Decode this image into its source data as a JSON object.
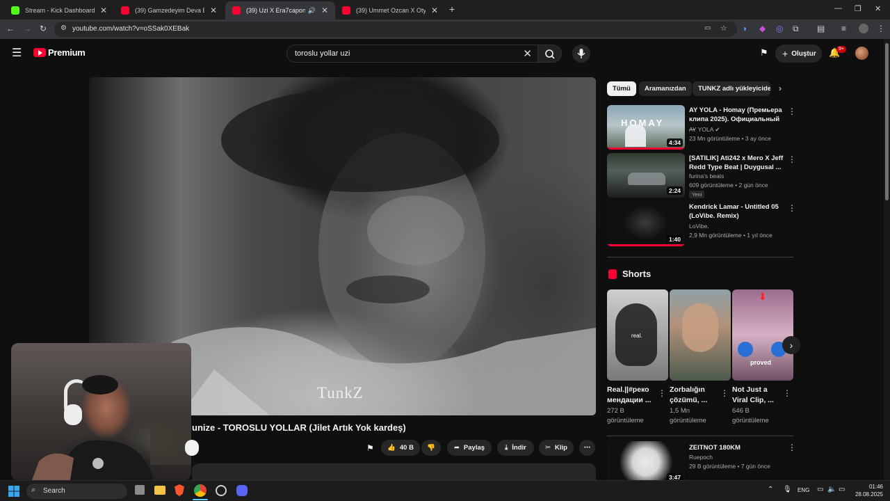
{
  "browser": {
    "tabs": [
      {
        "title": "Stream - Kick Dashboard",
        "favicon": "kick-icon",
        "color": "#53fc18",
        "active": false
      },
      {
        "title": "(39) Gamzedeyim Deva Bulmam",
        "favicon": "youtube-icon",
        "color": "#ff0033",
        "active": false
      },
      {
        "title": "(39) Uzi X Era7capone X Ov",
        "favicon": "youtube-icon",
        "color": "#ff0033",
        "active": true
      },
      {
        "title": "(39) Ummet Ozcan X Otyken Al",
        "favicon": "youtube-icon",
        "color": "#ff0033",
        "active": false
      }
    ],
    "url": "youtube.com/watch?v=oSSak0XEBak"
  },
  "youtube": {
    "logo_label": "Premium",
    "search": {
      "value": "toroslu yollar uzi"
    },
    "create_label": "Oluştur",
    "notif_count": "9+",
    "player": {
      "watermark": "TunkZ"
    },
    "video": {
      "title": "unize - TOROSLU YOLLAR (Jilet Artık Yok kardeş)",
      "likes": "40 B",
      "share_label": "Paylaş",
      "download_label": "İndir",
      "clip_label": "Klip"
    },
    "chips": [
      "Tümü",
      "Aramanızdan",
      "TUNKZ adlı yükleyiciden"
    ],
    "recommendations": [
      {
        "title": "AY YOLA - Homay (Премьера клипа 2025). Официальный ...",
        "channel": "AY YOLA",
        "meta": "23 Mn görüntüleme • 3 ay önce",
        "duration": "4:34",
        "progress": 1.0
      },
      {
        "title": "[SATILIK] Ati242 x Mero X Jeff Redd Type Beat | Duygusal ...",
        "channel": "furina's beats",
        "meta": "609 görüntüleme • 2 gün önce",
        "badge": "Yeni",
        "duration": "2:24",
        "progress": 0
      },
      {
        "title": "Kendrick Lamar - Untitled 05 (LoVibe. Remix)",
        "channel": "LoVibe.",
        "meta": "2,9 Mn görüntüleme • 1 yıl önce",
        "duration": "1:40",
        "progress": 1.0
      }
    ],
    "shorts_label": "Shorts",
    "shorts": [
      {
        "title": "Real.||#реко мендации ...",
        "views": "272 B görüntüleme",
        "overlay": "real."
      },
      {
        "title": "Zorbalığın çözümü, ...",
        "views": "1,5 Mn görüntüleme",
        "overlay": ""
      },
      {
        "title": "Not Just a Viral Clip, ...",
        "views": "646 B görüntüleme",
        "overlay": "proved"
      }
    ],
    "bottom_rec": {
      "title": "ZEITNOT 180KM",
      "channel": "Ruepoch",
      "meta": "29 B görüntüleme • 7 gün önce",
      "duration": "3:47"
    }
  },
  "taskbar": {
    "search_label": "Search",
    "lang": "ENG",
    "time": "01:46",
    "date": "28.08.2025"
  }
}
